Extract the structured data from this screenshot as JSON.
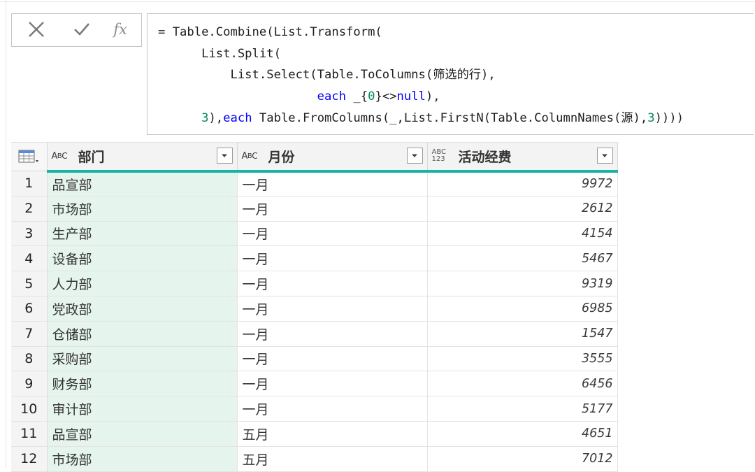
{
  "formula_bar": {
    "cancel_icon": "close-icon",
    "confirm_icon": "check-icon",
    "fx_label": "fx",
    "lines": [
      {
        "indent": "",
        "parts": [
          {
            "t": "= Table.Combine(List.Transform("
          }
        ]
      },
      {
        "indent": "      ",
        "parts": [
          {
            "t": "List.Split("
          }
        ]
      },
      {
        "indent": "          ",
        "parts": [
          {
            "t": "List.Select(Table.ToColumns("
          },
          {
            "t": "筛选的行",
            "c": "cn"
          },
          {
            "t": "),"
          }
        ]
      },
      {
        "indent": "                      ",
        "parts": [
          {
            "t": "each",
            "c": "kw"
          },
          {
            "t": " _{"
          },
          {
            "t": "0",
            "c": "num"
          },
          {
            "t": "}<>"
          },
          {
            "t": "null",
            "c": "kw"
          },
          {
            "t": "),"
          }
        ]
      },
      {
        "indent": "      ",
        "parts": [
          {
            "t": "3",
            "c": "num"
          },
          {
            "t": "),"
          },
          {
            "t": "each",
            "c": "kw"
          },
          {
            "t": " Table.FromColumns(_,List.FirstN(Table.ColumnNames("
          },
          {
            "t": "源",
            "c": "cn"
          },
          {
            "t": "),"
          },
          {
            "t": "3",
            "c": "num"
          },
          {
            "t": "))))"
          }
        ]
      }
    ]
  },
  "grid": {
    "columns": [
      {
        "name": "部门",
        "type_icon": "abc-text-type-icon",
        "type_label": "ABC"
      },
      {
        "name": "月份",
        "type_icon": "abc-text-type-icon",
        "type_label": "ABC"
      },
      {
        "name": "活动经费",
        "type_icon": "any-type-icon",
        "type_label_top": "ABC",
        "type_label_bottom": "123"
      }
    ],
    "rows": [
      {
        "n": "1",
        "dept": "品宣部",
        "month": "一月",
        "fee": "9972"
      },
      {
        "n": "2",
        "dept": "市场部",
        "month": "一月",
        "fee": "2612"
      },
      {
        "n": "3",
        "dept": "生产部",
        "month": "一月",
        "fee": "4154"
      },
      {
        "n": "4",
        "dept": "设备部",
        "month": "一月",
        "fee": "5467"
      },
      {
        "n": "5",
        "dept": "人力部",
        "month": "一月",
        "fee": "9319"
      },
      {
        "n": "6",
        "dept": "党政部",
        "month": "一月",
        "fee": "6985"
      },
      {
        "n": "7",
        "dept": "仓储部",
        "month": "一月",
        "fee": "1547"
      },
      {
        "n": "8",
        "dept": "采购部",
        "month": "一月",
        "fee": "3555"
      },
      {
        "n": "9",
        "dept": "财务部",
        "month": "一月",
        "fee": "6456"
      },
      {
        "n": "10",
        "dept": "审计部",
        "month": "一月",
        "fee": "5177"
      },
      {
        "n": "11",
        "dept": "品宣部",
        "month": "五月",
        "fee": "4651"
      },
      {
        "n": "12",
        "dept": "市场部",
        "month": "五月",
        "fee": "7012"
      }
    ],
    "accent_color": "#17b3a3",
    "selected_column_bg": "#e6f4ee"
  }
}
